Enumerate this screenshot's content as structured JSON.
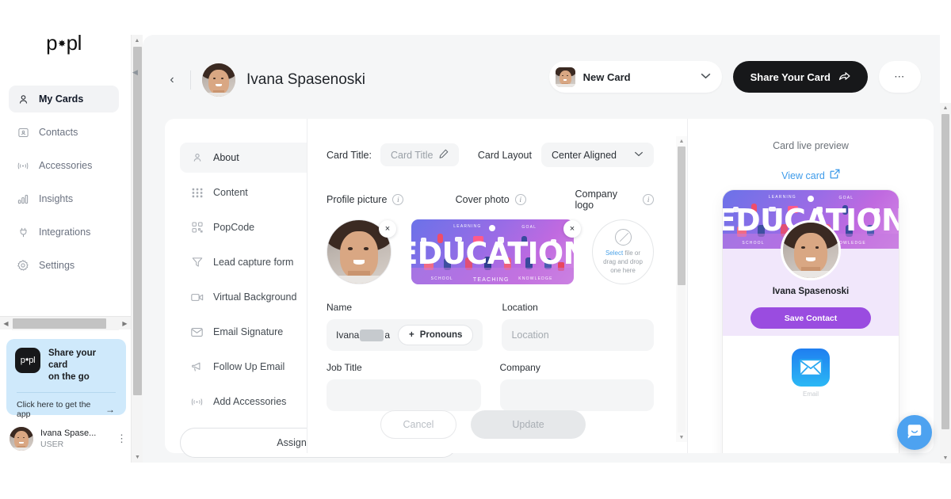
{
  "brand": {
    "name_left": "p",
    "name_glyph": "✸",
    "name_right": "pl"
  },
  "sidebar": {
    "items": [
      {
        "label": "My Cards",
        "icon": "person-icon",
        "active": true
      },
      {
        "label": "Contacts",
        "icon": "contacts-icon",
        "active": false
      },
      {
        "label": "Accessories",
        "icon": "nfc-icon",
        "active": false
      },
      {
        "label": "Insights",
        "icon": "bar-chart-icon",
        "active": false
      },
      {
        "label": "Integrations",
        "icon": "plug-icon",
        "active": false
      },
      {
        "label": "Settings",
        "icon": "gear-icon",
        "active": false
      }
    ],
    "promo": {
      "badge": "popl",
      "title_line1": "Share your card",
      "title_line2": "on the go",
      "link": "Click here to get the app",
      "arrow": "→"
    },
    "user": {
      "name": "Ivana Spase...",
      "role": "USER",
      "menu": "⋮"
    }
  },
  "header": {
    "back": "‹",
    "title": "Ivana Spasenoski",
    "card_select": {
      "value": "New Card",
      "chevron": "∨"
    },
    "share_button": {
      "label": "Share Your Card",
      "icon": "share-icon"
    },
    "more_button": {
      "label": "⋯"
    }
  },
  "inner_menu": {
    "items": [
      {
        "label": "About",
        "icon": "person-icon",
        "active": true
      },
      {
        "label": "Content",
        "icon": "grid-icon",
        "active": false
      },
      {
        "label": "PopCode",
        "icon": "qr-icon",
        "active": false
      },
      {
        "label": "Lead capture form",
        "icon": "funnel-icon",
        "active": false
      },
      {
        "label": "Virtual Background",
        "icon": "video-icon",
        "active": false
      },
      {
        "label": "Email Signature",
        "icon": "mail-icon",
        "active": false
      },
      {
        "label": "Follow Up Email",
        "icon": "megaphone-icon",
        "active": false
      },
      {
        "label": "Add Accessories",
        "icon": "nfc-icon",
        "active": false
      }
    ],
    "assign_button": "Assign to Template"
  },
  "form": {
    "card_title_label": "Card Title:",
    "card_title_placeholder": "Card Title",
    "card_title_edit_icon": "pencil-icon",
    "card_layout_label": "Card Layout",
    "card_layout_value": "Center Aligned",
    "card_layout_chevron": "∨",
    "media": {
      "profile_picture_label": "Profile picture",
      "cover_photo_label": "Cover photo",
      "company_logo_label": "Company logo",
      "info_icon": "i",
      "remove_icon": "×",
      "dropzone_link": "Select",
      "dropzone_text_1": " file or",
      "dropzone_text_2": "drag and drop",
      "dropzone_text_3": "one here"
    },
    "name_label": "Name",
    "name_value": "Ivana",
    "name_value_suffix": "a",
    "pronouns_button": "Pronouns",
    "pronouns_plus": "+",
    "location_label": "Location",
    "location_placeholder": "Location",
    "job_title_label": "Job Title",
    "company_label": "Company",
    "cancel_button": "Cancel",
    "update_button": "Update"
  },
  "preview": {
    "title": "Card live preview",
    "view_card_link": "View card",
    "external_icon": "external-link-icon",
    "card_name": "Ivana Spasenoski",
    "save_contact_button": "Save Contact",
    "email_label": "Email"
  },
  "cover_art": {
    "word": "EDUCATION",
    "caption_1": "LEARNING",
    "caption_2": "GOAL",
    "caption_3": "SCHOOL",
    "caption_4": "TEACHING",
    "caption_5": "KNOWLEDGE"
  },
  "chat": {
    "icon": "chat-bubble-icon"
  },
  "colors": {
    "accent_blue": "#3e9bea",
    "promo_bg": "#cfe9fb",
    "dark_button": "#17181a",
    "purple_cta": "#9a4ce0",
    "page_bg": "#f5f6f7",
    "chat_blue": "#4da2f0"
  }
}
